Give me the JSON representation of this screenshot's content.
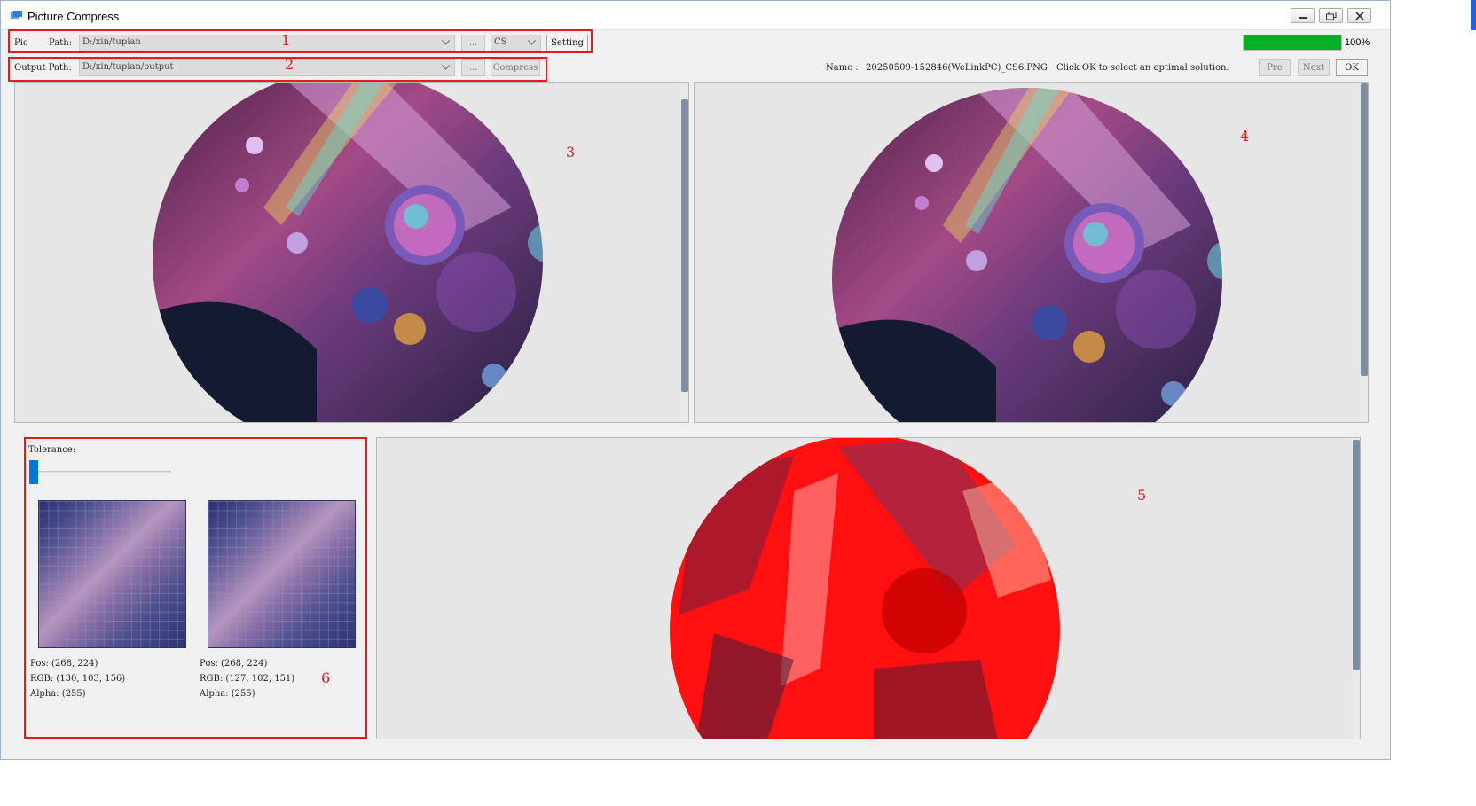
{
  "window": {
    "title": "Picture Compress"
  },
  "toolbar": {
    "pic_label": "Pic",
    "pic_path_label": "Path:",
    "pic_path_value": "D:/xin/tupian",
    "browse_label": "...",
    "format_value": "CS",
    "setting_label": "Setting",
    "output_label": "Output Path:",
    "output_path_value": "D:/xin/tupian/output",
    "browse2_label": "...",
    "compress_label": "Compress",
    "progress_percent": 100,
    "progress_text": "100%",
    "name_label": "Name :",
    "name_value": "20250509-152846(WeLinkPC)_CS6.PNG",
    "hint": "Click OK to select an optimal solution.",
    "pre_label": "Pre",
    "next_label": "Next",
    "ok_label": "OK"
  },
  "annotations": {
    "m1": "1",
    "m2": "2",
    "m3": "3",
    "m4": "4",
    "m5": "5",
    "m6": "6"
  },
  "tolerance": {
    "label": "Tolerance:",
    "value": 0
  },
  "pixel_left": {
    "pos": "Pos: (268, 224)",
    "rgb": "RGB: (130, 103, 156)",
    "alpha": "Alpha: (255)"
  },
  "pixel_right": {
    "pos": "Pos: (268, 224)",
    "rgb": "RGB: (127, 102, 151)",
    "alpha": "Alpha: (255)"
  },
  "colors": {
    "progress": "#06b025",
    "annotation": "#e01c1c",
    "slider": "#0078d7",
    "diff": "#ff1010"
  },
  "icons": [
    "app-icon",
    "minimize-icon",
    "restore-icon",
    "close-icon",
    "chevron-down-icon"
  ]
}
